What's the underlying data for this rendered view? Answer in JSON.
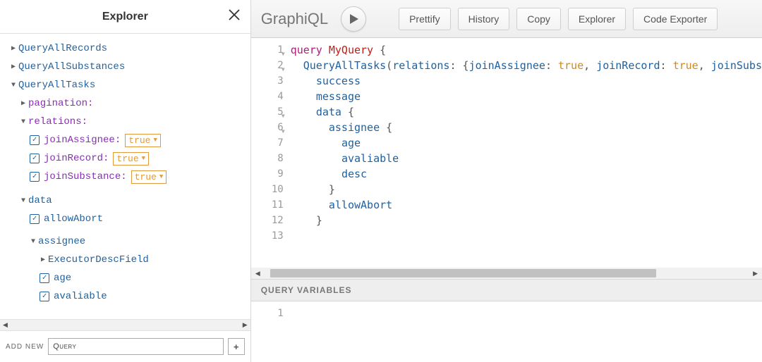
{
  "explorer": {
    "title": "Explorer",
    "queries": {
      "q1": "QueryAllRecords",
      "q2": "QueryAllSubstances",
      "q3": "QueryAllTasks"
    },
    "args": {
      "pagination": "pagination:",
      "relations": "relations:",
      "joinAssignee": "joinAssignee: ",
      "joinAssignee_val": "true",
      "joinRecord": "joinRecord: ",
      "joinRecord_val": "true",
      "joinSubstance": "joinSubstance: ",
      "joinSubstance_val": "true"
    },
    "fields": {
      "data": "data",
      "allowAbort": "allowAbort",
      "assignee": "assignee",
      "ExecutorDescField": "ExecutorDescField",
      "age": "age",
      "avaliable": "avaliable"
    },
    "footer": {
      "label": "add new",
      "input_value": "Query"
    }
  },
  "topbar": {
    "logo": "GraphiQL",
    "buttons": {
      "prettify": "Prettify",
      "history": "History",
      "copy": "Copy",
      "explorer": "Explorer",
      "codeExporter": "Code Exporter"
    }
  },
  "editor": {
    "lines": {
      "l1": {
        "n": "1"
      },
      "l2": {
        "n": "2"
      },
      "l3": {
        "n": "3"
      },
      "l4": {
        "n": "4"
      },
      "l5": {
        "n": "5"
      },
      "l6": {
        "n": "6"
      },
      "l7": {
        "n": "7"
      },
      "l8": {
        "n": "8"
      },
      "l9": {
        "n": "9"
      },
      "l10": {
        "n": "10"
      },
      "l11": {
        "n": "11"
      },
      "l12": {
        "n": "12"
      },
      "l13": {
        "n": "13"
      }
    },
    "code": {
      "kw_query": "query",
      "name": "MyQuery",
      "root": "QueryAllTasks",
      "arg_relations": "relations",
      "arg_joinAssignee": "joinAssignee",
      "arg_joinRecord": "joinRecord",
      "arg_joinSubs": "joinSubs",
      "true": "true",
      "success": "success",
      "message": "message",
      "data": "data",
      "assignee": "assignee",
      "age": "age",
      "avaliable": "avaliable",
      "desc": "desc",
      "allowAbort": "allowAbort"
    }
  },
  "vars": {
    "header": "QUERY VARIABLES",
    "line1": "1"
  }
}
